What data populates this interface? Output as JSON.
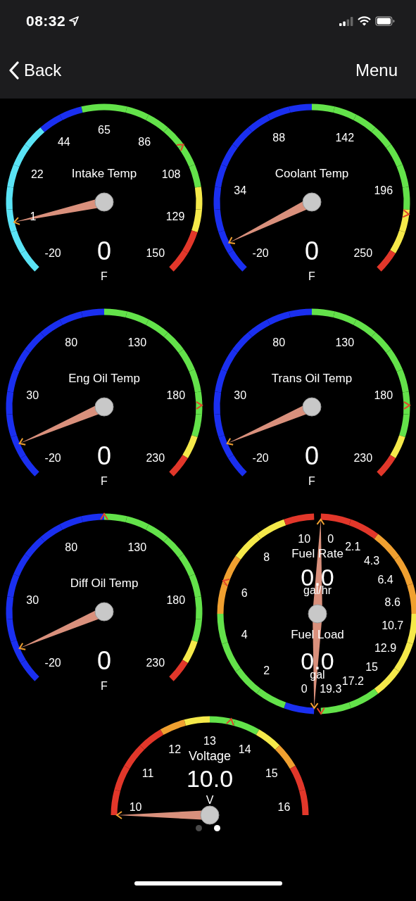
{
  "status_bar": {
    "time": "08:32"
  },
  "nav_bar": {
    "back": "Back",
    "menu": "Menu"
  },
  "gauges": [
    {
      "kind": "dial",
      "title": "Intake Temp",
      "value": "0",
      "unit": "F",
      "ticks": [
        "-20",
        "1",
        "22",
        "44",
        "65",
        "86",
        "108",
        "129",
        "150"
      ],
      "bands": [
        {
          "color": "#5ae3f5"
        },
        {
          "color": "#5ae3f5"
        },
        {
          "color": "#5ae3f5"
        },
        {
          "color": "#5ae3f5"
        },
        {
          "color": "#5ae3f5"
        },
        {
          "color": "#5ae3f5"
        },
        {
          "color": "#5ae3f5"
        },
        {
          "color": "#1a2ff0"
        },
        {
          "color": "#1a2ff0"
        },
        {
          "color": "#63e24a"
        },
        {
          "color": "#63e24a"
        },
        {
          "color": "#63e24a"
        },
        {
          "color": "#63e24a"
        },
        {
          "color": "#63e24a"
        },
        {
          "color": "#63e24a"
        },
        {
          "color": "#63e24a"
        },
        {
          "color": "#f5e94a"
        },
        {
          "color": "#f5e94a"
        },
        {
          "color": "#e2372a"
        },
        {
          "color": "#e2372a"
        }
      ]
    },
    {
      "kind": "dial",
      "title": "Coolant Temp",
      "value": "0",
      "unit": "F",
      "ticks": [
        "-20",
        "34",
        "88",
        "142",
        "196",
        "250"
      ],
      "bands": [
        {
          "color": "#1a2ff0"
        },
        {
          "color": "#1a2ff0"
        },
        {
          "color": "#1a2ff0"
        },
        {
          "color": "#1a2ff0"
        },
        {
          "color": "#1a2ff0"
        },
        {
          "color": "#1a2ff0"
        },
        {
          "color": "#1a2ff0"
        },
        {
          "color": "#1a2ff0"
        },
        {
          "color": "#1a2ff0"
        },
        {
          "color": "#1a2ff0"
        },
        {
          "color": "#63e24a"
        },
        {
          "color": "#63e24a"
        },
        {
          "color": "#63e24a"
        },
        {
          "color": "#63e24a"
        },
        {
          "color": "#63e24a"
        },
        {
          "color": "#63e24a"
        },
        {
          "color": "#63e24a"
        },
        {
          "color": "#f5e94a"
        },
        {
          "color": "#f5e94a"
        },
        {
          "color": "#e2372a"
        }
      ]
    },
    {
      "kind": "dial",
      "title": "Eng Oil Temp",
      "value": "0",
      "unit": "F",
      "ticks": [
        "-20",
        "30",
        "80",
        "130",
        "180",
        "230"
      ],
      "bands": [
        {
          "color": "#1a2ff0"
        },
        {
          "color": "#1a2ff0"
        },
        {
          "color": "#1a2ff0"
        },
        {
          "color": "#1a2ff0"
        },
        {
          "color": "#1a2ff0"
        },
        {
          "color": "#1a2ff0"
        },
        {
          "color": "#1a2ff0"
        },
        {
          "color": "#1a2ff0"
        },
        {
          "color": "#1a2ff0"
        },
        {
          "color": "#1a2ff0"
        },
        {
          "color": "#63e24a"
        },
        {
          "color": "#63e24a"
        },
        {
          "color": "#63e24a"
        },
        {
          "color": "#63e24a"
        },
        {
          "color": "#63e24a"
        },
        {
          "color": "#63e24a"
        },
        {
          "color": "#63e24a"
        },
        {
          "color": "#63e24a"
        },
        {
          "color": "#f5e94a"
        },
        {
          "color": "#e2372a"
        }
      ]
    },
    {
      "kind": "dial",
      "title": "Trans Oil Temp",
      "value": "0",
      "unit": "F",
      "ticks": [
        "-20",
        "30",
        "80",
        "130",
        "180",
        "230"
      ],
      "bands": [
        {
          "color": "#1a2ff0"
        },
        {
          "color": "#1a2ff0"
        },
        {
          "color": "#1a2ff0"
        },
        {
          "color": "#1a2ff0"
        },
        {
          "color": "#1a2ff0"
        },
        {
          "color": "#1a2ff0"
        },
        {
          "color": "#1a2ff0"
        },
        {
          "color": "#1a2ff0"
        },
        {
          "color": "#1a2ff0"
        },
        {
          "color": "#1a2ff0"
        },
        {
          "color": "#63e24a"
        },
        {
          "color": "#63e24a"
        },
        {
          "color": "#63e24a"
        },
        {
          "color": "#63e24a"
        },
        {
          "color": "#63e24a"
        },
        {
          "color": "#63e24a"
        },
        {
          "color": "#63e24a"
        },
        {
          "color": "#63e24a"
        },
        {
          "color": "#f5e94a"
        },
        {
          "color": "#e2372a"
        }
      ]
    },
    {
      "kind": "dial",
      "title": "Diff Oil Temp",
      "value": "0",
      "unit": "F",
      "ticks": [
        "-20",
        "30",
        "80",
        "130",
        "180",
        "230"
      ],
      "bands": [
        {
          "color": "#1a2ff0"
        },
        {
          "color": "#1a2ff0"
        },
        {
          "color": "#1a2ff0"
        },
        {
          "color": "#1a2ff0"
        },
        {
          "color": "#1a2ff0"
        },
        {
          "color": "#1a2ff0"
        },
        {
          "color": "#1a2ff0"
        },
        {
          "color": "#1a2ff0"
        },
        {
          "color": "#1a2ff0"
        },
        {
          "color": "#1a2ff0"
        },
        {
          "color": "#63e24a"
        },
        {
          "color": "#63e24a"
        },
        {
          "color": "#63e24a"
        },
        {
          "color": "#63e24a"
        },
        {
          "color": "#63e24a"
        },
        {
          "color": "#63e24a"
        },
        {
          "color": "#63e24a"
        },
        {
          "color": "#63e24a"
        },
        {
          "color": "#f5e94a"
        },
        {
          "color": "#e2372a"
        }
      ]
    },
    {
      "kind": "split",
      "halves": [
        {
          "title": "Fuel Rate",
          "value": "0.0",
          "unit": "gal/hr",
          "ticks": [
            "0",
            "2",
            "4",
            "6",
            "8",
            "10"
          ],
          "bands": [
            {
              "color": "#1a2ff0"
            },
            {
              "color": "#63e24a"
            },
            {
              "color": "#63e24a"
            },
            {
              "color": "#63e24a"
            },
            {
              "color": "#63e24a"
            },
            {
              "color": "#f0a030"
            },
            {
              "color": "#f0a030"
            },
            {
              "color": "#f5e94a"
            },
            {
              "color": "#f5e94a"
            },
            {
              "color": "#e2372a"
            }
          ]
        },
        {
          "title": "Fuel Load",
          "value": "0.0",
          "unit": "gal",
          "ticks": [
            "0",
            "2.1",
            "4.3",
            "6.4",
            "8.6",
            "10.7",
            "12.9",
            "15",
            "17.2",
            "19.3"
          ],
          "bands": [
            {
              "color": "#e2372a"
            },
            {
              "color": "#e2372a"
            },
            {
              "color": "#f0a030"
            },
            {
              "color": "#f0a030"
            },
            {
              "color": "#f0a030"
            },
            {
              "color": "#f5e94a"
            },
            {
              "color": "#f5e94a"
            },
            {
              "color": "#f5e94a"
            },
            {
              "color": "#63e24a"
            },
            {
              "color": "#63e24a"
            }
          ]
        }
      ]
    },
    {
      "kind": "half",
      "title": "Voltage",
      "value": "10.0",
      "unit": "V",
      "ticks": [
        "10",
        "11",
        "12",
        "13",
        "14",
        "15",
        "16"
      ],
      "bands": [
        {
          "color": "#e2372a"
        },
        {
          "color": "#e2372a"
        },
        {
          "color": "#e2372a"
        },
        {
          "color": "#e2372a"
        },
        {
          "color": "#f0a030"
        },
        {
          "color": "#f5e94a"
        },
        {
          "color": "#63e24a"
        },
        {
          "color": "#63e24a"
        },
        {
          "color": "#f5e94a"
        },
        {
          "color": "#f0a030"
        },
        {
          "color": "#e2372a"
        },
        {
          "color": "#e2372a"
        }
      ]
    }
  ],
  "pages": [
    {
      "selected": false
    },
    {
      "selected": true
    }
  ]
}
